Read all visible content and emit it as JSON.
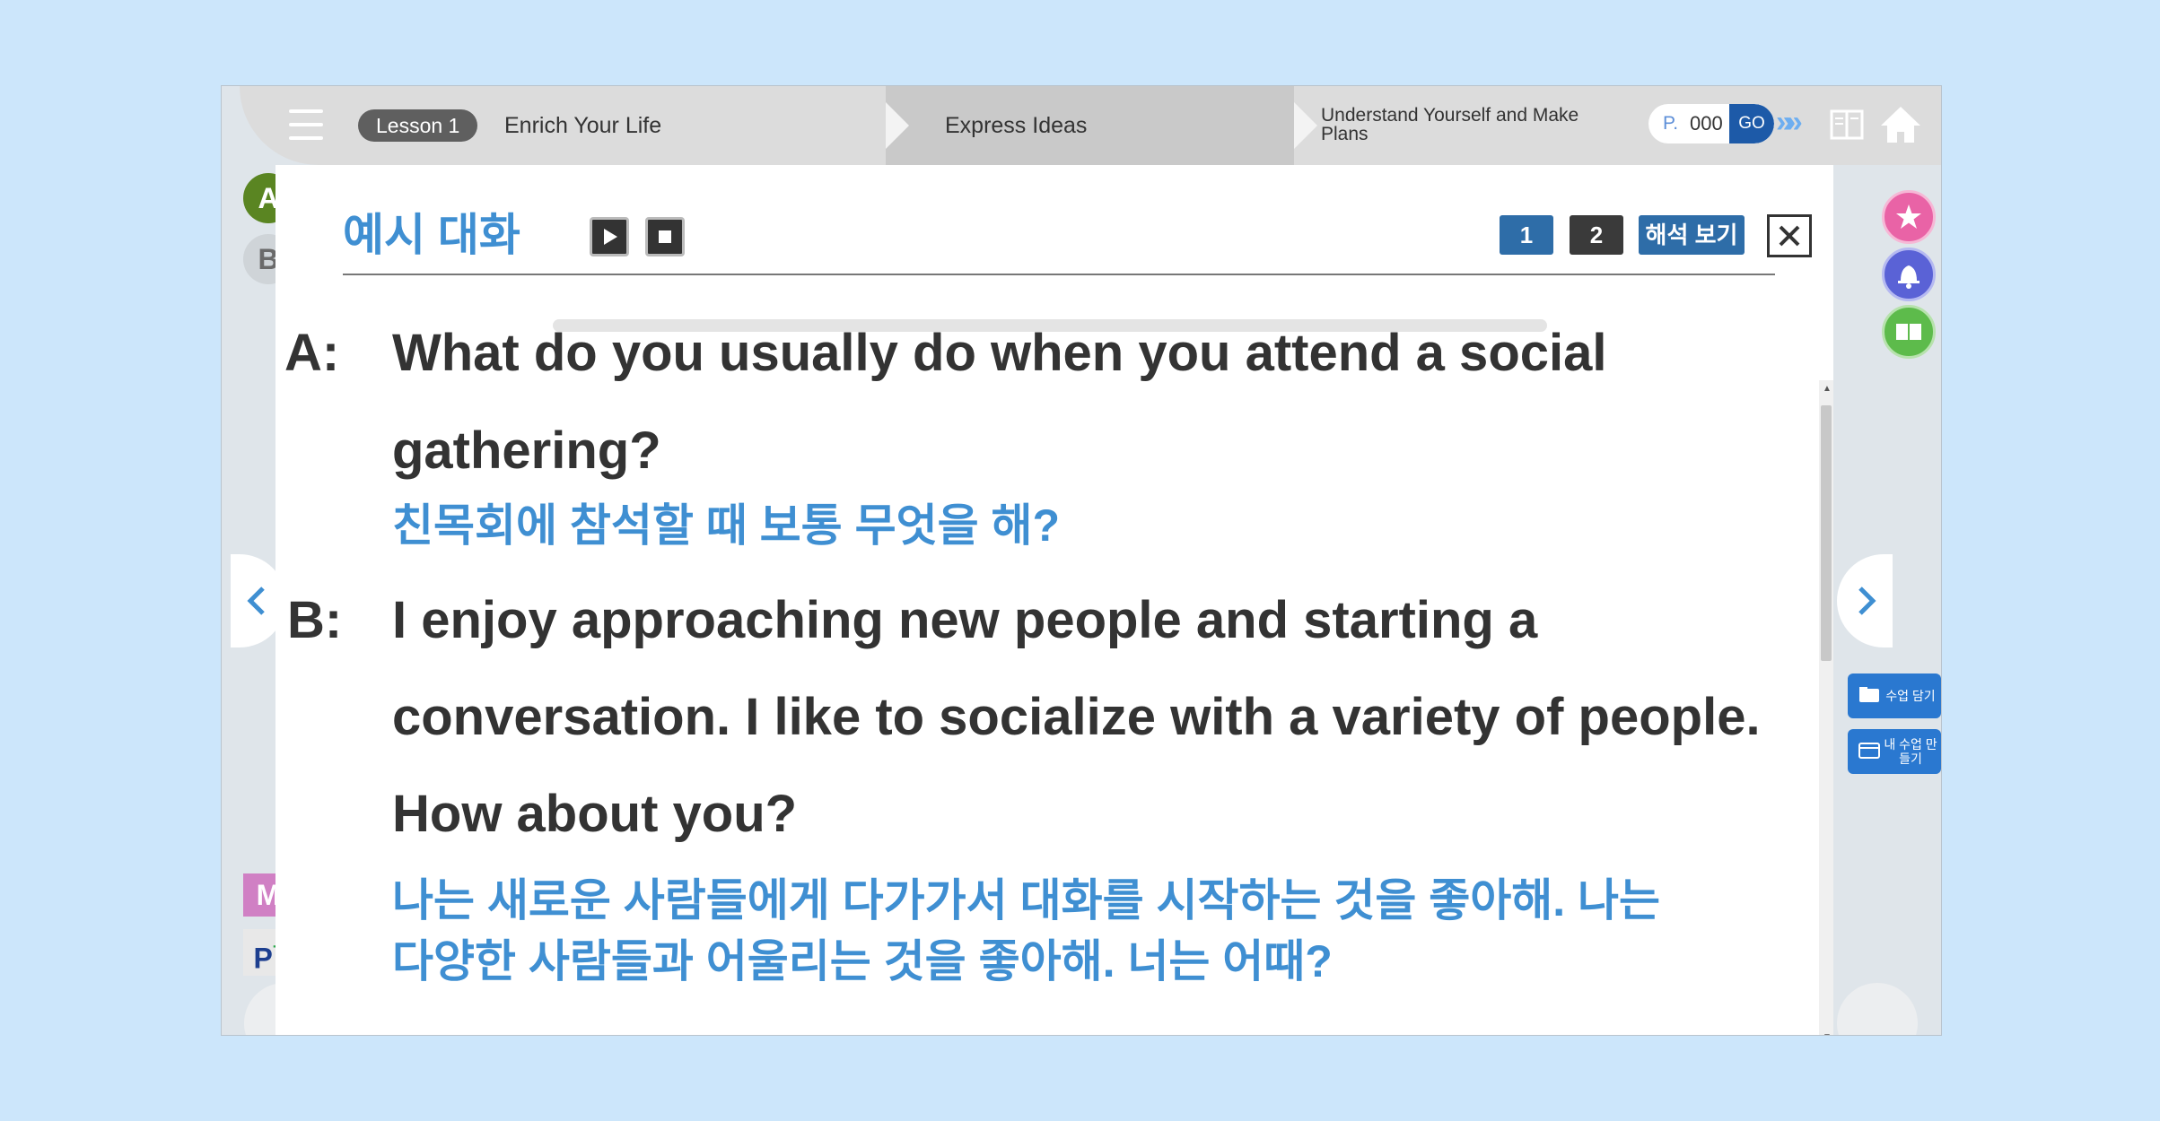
{
  "topbar": {
    "lesson_pill": "Lesson 1",
    "lesson_title": "Enrich Your Life",
    "step_2": "Express Ideas",
    "step_3": "Understand Yourself and Make Plans",
    "page_prefix": "P.",
    "page_number": "000",
    "go_label": "GO",
    "chevrons": "»»"
  },
  "left_rail": {
    "a_label": "A",
    "b_label": "B",
    "m_label": "M",
    "p_label": "P",
    "p_sup": "+"
  },
  "right_rail": {
    "button_1": "수업 담기",
    "button_2": "내 수업 만들기"
  },
  "panel": {
    "title": "예시 대화",
    "page_btn_1": "1",
    "page_btn_2": "2",
    "interpret_label": "해석 보기"
  },
  "dialogue": {
    "a_speaker": "A:",
    "a_line_1": "What do you usually do when you attend a social",
    "a_line_2": "gathering?",
    "a_translation": "친목회에 참석할 때 보통 무엇을 해?",
    "b_speaker": "B:",
    "b_line_1": "I enjoy approaching new people and starting a",
    "b_line_2": "conversation. I like to socialize with a variety of people.",
    "b_line_3": "How about you?",
    "b_translation_1": "나는 새로운 사람들에게 다가가서 대화를 시작하는 것을 좋아해. 나는",
    "b_translation_2": "다양한 사람들과 어울리는 것을 좋아해. 너는 어때?"
  },
  "colors": {
    "accent_blue": "#3f8fd2",
    "dark_button": "#3a3a3a",
    "go_button": "#1d5aa8",
    "a_badge": "#5a8522",
    "m_badge": "#d080c4"
  }
}
